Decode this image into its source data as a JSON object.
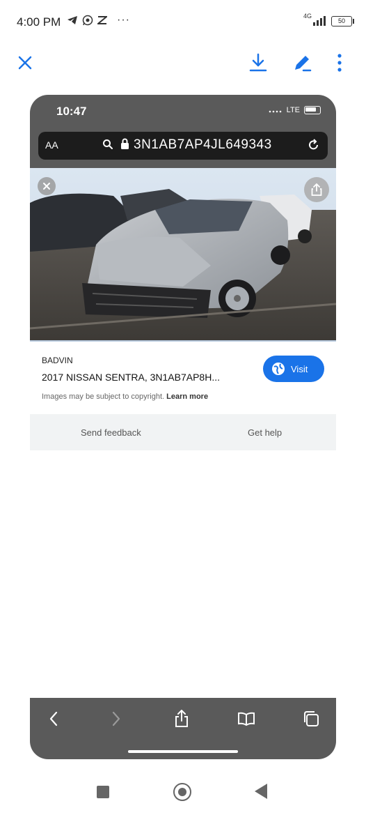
{
  "status_bar": {
    "time": "4:00 PM",
    "more": "···",
    "network": "4G",
    "battery": "50"
  },
  "toolbar": {
    "close_icon": "close-icon",
    "download_icon": "download-icon",
    "edit_icon": "edit-icon",
    "more_icon": "more-vert-icon",
    "accent_color": "#1a73e8"
  },
  "screenshot": {
    "ios_time": "10:47",
    "ios_network": "LTE",
    "url_aa": "AA",
    "url": "3N1AB7AP4JL649343",
    "result": {
      "site": "BADVIN",
      "title": "2017 NISSAN SENTRA, 3N1AB7AP8H...",
      "copyright_text": "Images may be subject to copyright.",
      "learn_more": "Learn more",
      "visit_label": "Visit"
    },
    "feedback": {
      "send": "Send feedback",
      "help": "Get help"
    }
  }
}
